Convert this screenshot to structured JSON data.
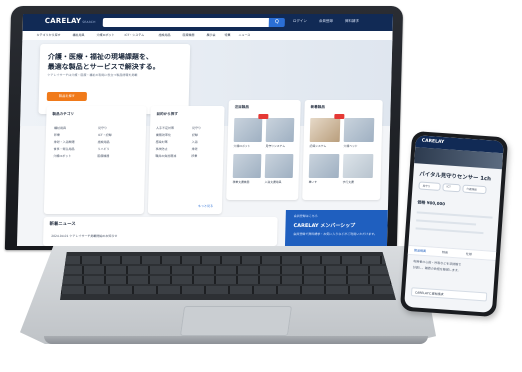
{
  "site": {
    "logo": "CARELAY",
    "logo_sub": "SEARCH",
    "search_button": "Q",
    "header_links": [
      "ログイン",
      "会員登録",
      "資料請求"
    ],
    "nav": [
      "カテゴリから探す",
      "福祉用具",
      "介護ロボット",
      "ICT・システム",
      "施設用品",
      "医療機器",
      "展示会",
      "特集",
      "ニュース"
    ]
  },
  "hero": {
    "title_line1": "介護・医療・福祉の現場課題を、",
    "title_line2": "最適な製品とサービスで解決する。",
    "subtitle": "ケアレイサーチは介護・医療・福祉の現場に役立つ製品情報を掲載",
    "button": "製品を探す"
  },
  "panels": {
    "category_title": "製品カテゴリ",
    "category_col1": [
      "福祉用具",
      "移乗",
      "排泄・入浴関連",
      "食事・衛生用品",
      "介護ロボット"
    ],
    "category_col2": [
      "見守り",
      "ICT・記録",
      "施設用品",
      "リハビリ",
      "医療機器"
    ],
    "purpose_title": "目的から探す",
    "purpose_col1": [
      "人手不足対策",
      "業務効率化",
      "感染対策",
      "事故防止",
      "職員の負担軽減"
    ],
    "purpose_col2": [
      "見守り",
      "記録",
      "入浴",
      "排泄",
      "移乗"
    ],
    "more_link": "もっと見る",
    "pick_title1": "注目製品",
    "pick_title2": "新着製品",
    "pick_captions": [
      "介護ロボット",
      "見守りシステム",
      "移乗支援機器",
      "入浴支援用具",
      "記録システム",
      "介護ベッド",
      "車いす",
      "歩行支援"
    ],
    "tag": "NEW"
  },
  "news": {
    "title": "新着ニュース",
    "item": "2024.04.01 ケアレイサーチ掲載開始のお知らせ"
  },
  "member": {
    "label": "会員登録はこちら",
    "title": "CARELAY メンバーシップ",
    "desc": "会員登録で資料請求・お気に入りなどがご利用いただけます。"
  },
  "phone": {
    "logo": "CARELAY",
    "title": "バイタル見守りセンサー",
    "title_suffix": " 1ch",
    "chips": [
      "見守り",
      "ICT",
      "介護施設"
    ],
    "price": "価格 ¥00,000",
    "tabs": [
      "製品概要",
      "特長",
      "仕様"
    ],
    "body1": "利用者の心拍・呼吸などを非接触で",
    "body2": "計測し、職員の負担を軽減します。",
    "footer": "CARELAYに資料請求"
  },
  "colors": {
    "navy": "#112a55",
    "orange": "#f07a1a",
    "blue": "#1f5fbf",
    "red": "#e53935"
  }
}
